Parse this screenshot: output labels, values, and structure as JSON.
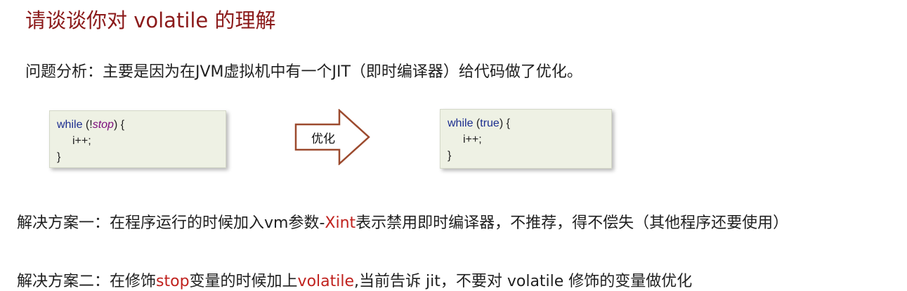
{
  "title": "请谈谈你对 volatile 的理解",
  "analysis": "问题分析：主要是因为在JVM虚拟机中有一个JIT（即时编译器）给代码做了优化。",
  "code_before": {
    "line1_kw": "while",
    "line1_open": " (!",
    "line1_var": "stop",
    "line1_close": ") {",
    "line2": "i++;",
    "line3": "}"
  },
  "arrow_label": "优化",
  "code_after": {
    "line1_kw": "while",
    "line1_open": " (",
    "line1_lit": "true",
    "line1_close": ") {",
    "line2": "i++;",
    "line3": "}"
  },
  "solution_one": {
    "prefix": "解决方案一：在程序运行的时候加入vm参数-",
    "highlight": "Xint",
    "suffix": "表示禁用即时编译器，不推荐，得不偿失（其他程序还要使用）"
  },
  "solution_two": {
    "prefix": "解决方案二：在修饰",
    "highlight1": "stop",
    "middle": "变量的时候加上",
    "highlight2": "volatile",
    "suffix": ",当前告诉 jit，不要对 volatile 修饰的变量做优化"
  },
  "colors": {
    "title": "#8b1a1a",
    "highlight": "#c0221e",
    "code_bg": "#eef1e4",
    "arrow_stroke": "#9c4a2e"
  }
}
